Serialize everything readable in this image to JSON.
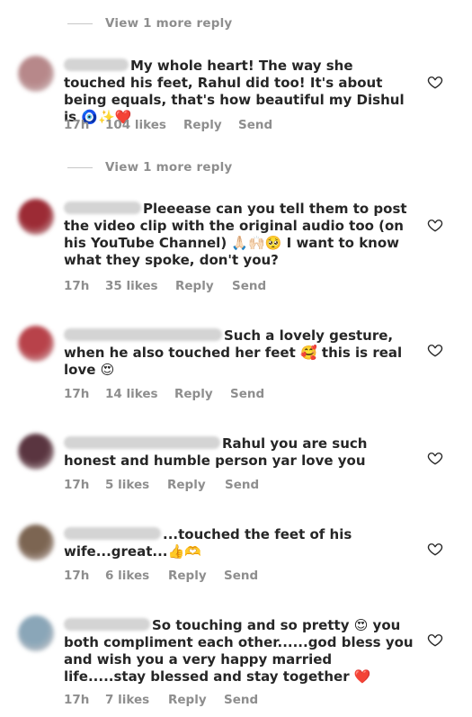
{
  "view_more_1": "View 1 more reply",
  "view_more_2": "View 1 more reply",
  "comments": [
    {
      "avatar_color": "#b7888a",
      "text": "My whole heart! The way she touched his feet, Rahul did too! It's about being equals, that's how beautiful my Dishul is 🧿✨❤️",
      "time": "17h",
      "likes": "104 likes",
      "reply": "Reply",
      "send": "Send"
    },
    {
      "avatar_color": "#9c2b35",
      "text": "Pleeease can you tell them to post the video clip with the original audio too (on his YouTube Channel) 🙏🏻🙌🏻🥺 I want to know what they spoke, don't you?",
      "time": "17h",
      "likes": "35 likes",
      "reply": "Reply",
      "send": "Send"
    },
    {
      "avatar_color": "#b8424a",
      "text": "Such a lovely gesture, when he also touched her feet 🥰 this is real love 😍",
      "time": "17h",
      "likes": "14 likes",
      "reply": "Reply",
      "send": "Send"
    },
    {
      "avatar_color": "#5a3540",
      "text": "Rahul you are such honest and humble person yar love you",
      "time": "17h",
      "likes": "5 likes",
      "reply": "Reply",
      "send": "Send"
    },
    {
      "avatar_color": "#7c6552",
      "text": "...touched the feet of his wife...great...👍🫶",
      "time": "17h",
      "likes": "6 likes",
      "reply": "Reply",
      "send": "Send"
    },
    {
      "avatar_color": "#8aa6b8",
      "text": "So touching and so pretty 😍 you both compliment each other......god bless you and wish you a very happy married life.....stay blessed and stay together ❤️",
      "time": "17h",
      "likes": "7 likes",
      "reply": "Reply",
      "send": "Send"
    }
  ]
}
